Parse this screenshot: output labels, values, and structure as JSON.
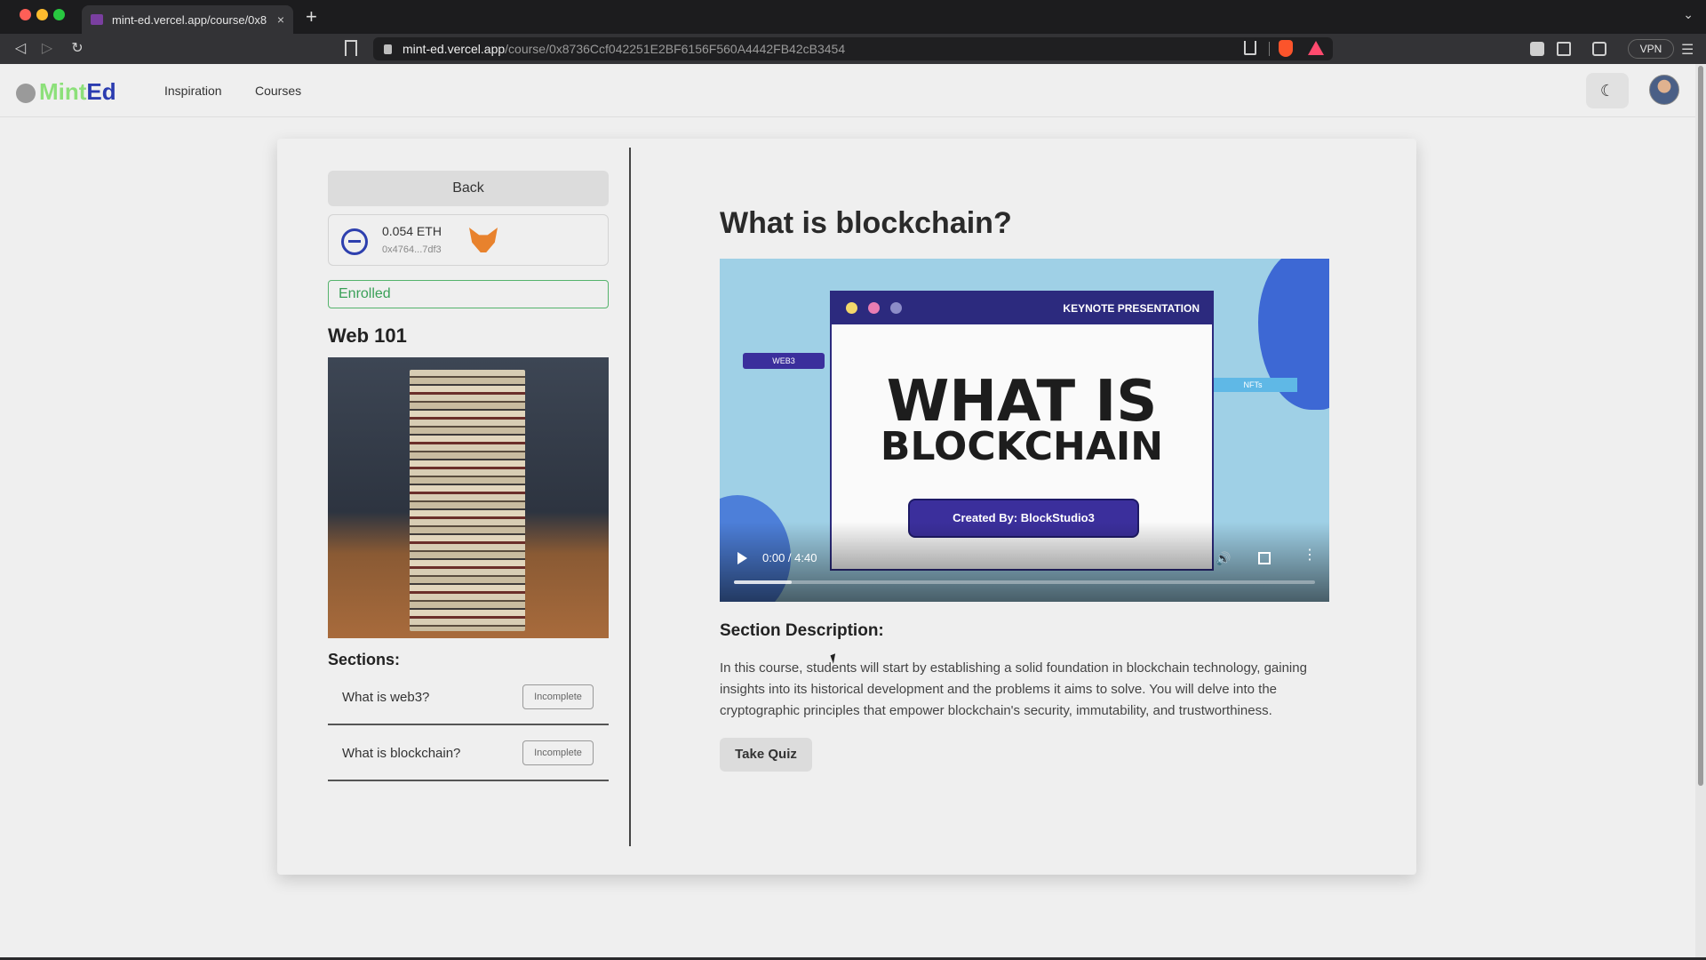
{
  "browser": {
    "tab_title": "mint-ed.vercel.app/course/0x8",
    "url_host": "mint-ed.vercel.app",
    "url_path": "/course/0x8736Ccf042251E2BF6156F560A4442FB42cB3454",
    "vpn_label": "VPN",
    "new_tab": "+",
    "tab_close": "×"
  },
  "site": {
    "logo_part1": "Mint",
    "logo_part2": "Ed",
    "nav": [
      "Inspiration",
      "Courses"
    ],
    "theme_icon": "☾"
  },
  "sidebar": {
    "back_label": "Back",
    "wallet": {
      "amount": "0.054 ETH",
      "address": "0x4764...7df3"
    },
    "enrolled_label": "Enrolled",
    "course_title": "Web 101",
    "sections_label": "Sections:",
    "sections": [
      {
        "title": "What is web3?",
        "status": "Incomplete"
      },
      {
        "title": "What is blockchain?",
        "status": "Incomplete"
      }
    ]
  },
  "main": {
    "title": "What is blockchain?",
    "video": {
      "keynote_label": "KEYNOTE PRESENTATION",
      "line1": "WHAT IS",
      "line2": "BLOCKCHAIN",
      "created_by": "Created By: BlockStudio3",
      "tag_web3": "WEB3",
      "tag_nfts": "NFTs",
      "time": "0:00 / 4:40",
      "buffered_fraction": 0.1
    },
    "description_label": "Section Description:",
    "description": "In this course, students will start by establishing a solid foundation in blockchain technology, gaining insights into its historical development and the problems it aims to solve. You will delve into the cryptographic principles that empower blockchain's security, immutability, and trustworthiness.",
    "quiz_label": "Take Quiz"
  },
  "colors": {
    "mint": "#8ce07a",
    "ed": "#2b3cb0",
    "enrolled": "#3aa058",
    "keynote": "#2c2a7e"
  }
}
